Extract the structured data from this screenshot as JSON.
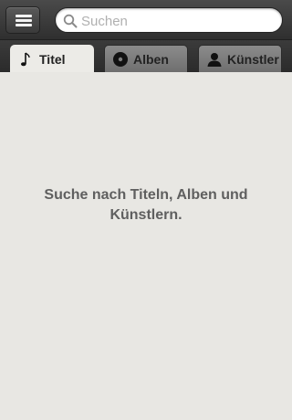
{
  "header": {
    "menu_icon": "hamburger-menu-icon",
    "search": {
      "placeholder": "Suchen",
      "value": "",
      "icon": "search-icon"
    }
  },
  "tabs": [
    {
      "label": "Titel",
      "icon": "music-note-icon",
      "active": true
    },
    {
      "label": "Alben",
      "icon": "disc-icon",
      "active": false
    },
    {
      "label": "Künstler",
      "icon": "person-icon",
      "active": false
    }
  ],
  "main": {
    "empty_message": "Suche nach Titeln, Alben und Künstlern."
  },
  "colors": {
    "topbar": "#3a3a3a",
    "background": "#e8e7e3",
    "active_tab": "#ecebe7",
    "inactive_tab": "#7d7d7d",
    "message_text": "#5f5f5f"
  }
}
